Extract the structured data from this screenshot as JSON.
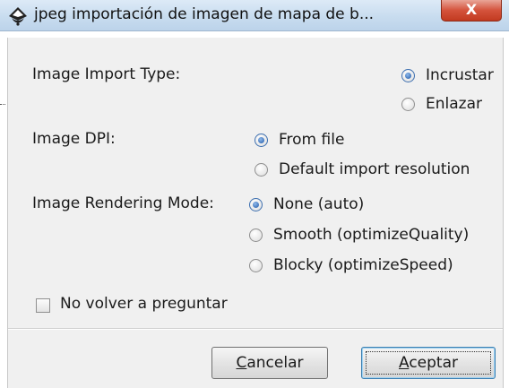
{
  "window": {
    "title": "jpeg importación de imagen de mapa de b...",
    "icon": "inkscape-icon",
    "close_label": "X",
    "close_color": "#c9432b"
  },
  "import_type": {
    "label": "Image Import Type:",
    "options": [
      {
        "label": "Incrustar",
        "checked": true
      },
      {
        "label": "Enlazar",
        "checked": false
      }
    ]
  },
  "dpi": {
    "label": "Image DPI:",
    "options": [
      {
        "label": "From file",
        "checked": true
      },
      {
        "label": "Default import resolution",
        "checked": false
      }
    ]
  },
  "rendering": {
    "label": "Image Rendering Mode:",
    "options": [
      {
        "label": "None (auto)",
        "checked": true
      },
      {
        "label": "Smooth (optimizeQuality)",
        "checked": false
      },
      {
        "label": "Blocky (optimizeSpeed)",
        "checked": false
      }
    ]
  },
  "dont_ask": {
    "label": "No volver a preguntar",
    "checked": false
  },
  "buttons": {
    "cancel": {
      "mnemonic": "C",
      "rest": "ancelar"
    },
    "ok": {
      "mnemonic": "A",
      "rest": "ceptar"
    }
  }
}
